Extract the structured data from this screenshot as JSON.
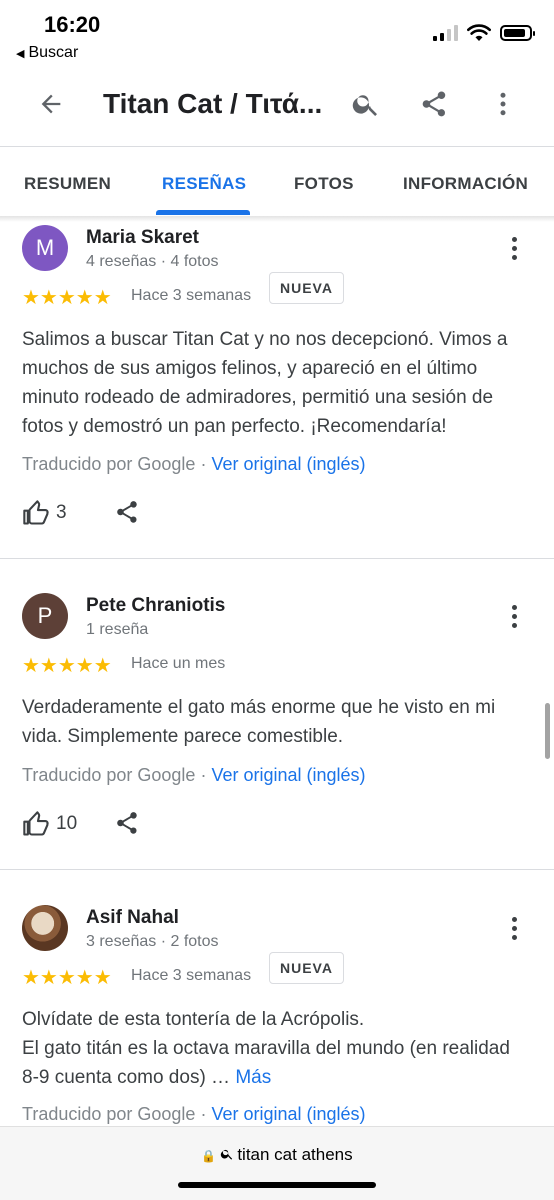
{
  "status_bar": {
    "time": "16:20",
    "back_app": "Buscar",
    "icons": [
      "cellular-signal",
      "wifi",
      "battery"
    ]
  },
  "app_bar": {
    "title": "Titan Cat / Τιτά...",
    "icons": [
      "back-arrow-icon",
      "search-icon",
      "share-icon",
      "more-vert-icon"
    ]
  },
  "tabs": [
    {
      "label": "RESUMEN",
      "active": false
    },
    {
      "label": "RESEÑAS",
      "active": true
    },
    {
      "label": "FOTOS",
      "active": false
    },
    {
      "label": "INFORMACIÓN",
      "active": false
    }
  ],
  "reviews": [
    {
      "avatar_letter": "M",
      "avatar_color": "#7e57c2",
      "name": "Maria Skaret",
      "meta": "4 reseñas · 4 fotos",
      "rating": 5,
      "stars": "★★★★★",
      "time": "Hace 3 semanas",
      "badge": "NUEVA",
      "text": "Salimos a buscar Titan Cat y no nos decepcionó. Vimos a muchos de sus amigos felinos, y apareció en el último minuto rodeado de admiradores, permitió una sesión de fotos y demostró un pan perfecto. ¡Recomendaría!",
      "translated_by": "Traducido por Google",
      "original_link": "Ver original (inglés)",
      "likes": "3"
    },
    {
      "avatar_letter": "P",
      "avatar_color": "#5d4037",
      "name": "Pete Chraniotis",
      "meta": "1 reseña",
      "rating": 5,
      "stars": "★★★★★",
      "time": "Hace un mes",
      "text": "Verdaderamente el gato más enorme que he visto en mi vida. Simplemente parece comestible.",
      "translated_by": "Traducido por Google",
      "original_link": "Ver original (inglés)",
      "likes": "10"
    },
    {
      "name": "Asif Nahal",
      "meta": "3 reseñas · 2 fotos",
      "rating": 5,
      "stars": "★★★★★",
      "time": "Hace 3 semanas",
      "badge": "NUEVA",
      "text_line1": "Olvídate de esta tontería de la Acrópolis.",
      "text_line2": "El gato titán es la octava maravilla del mundo (en realidad 8-9 cuenta como dos) …",
      "more_label": "Más",
      "translated_by": "Traducido por Google",
      "original_link": "Ver original (inglés)"
    }
  ],
  "browser": {
    "url_text": "titan cat athens"
  },
  "colors": {
    "accent": "#1a73e8",
    "star": "#fbbc04"
  }
}
